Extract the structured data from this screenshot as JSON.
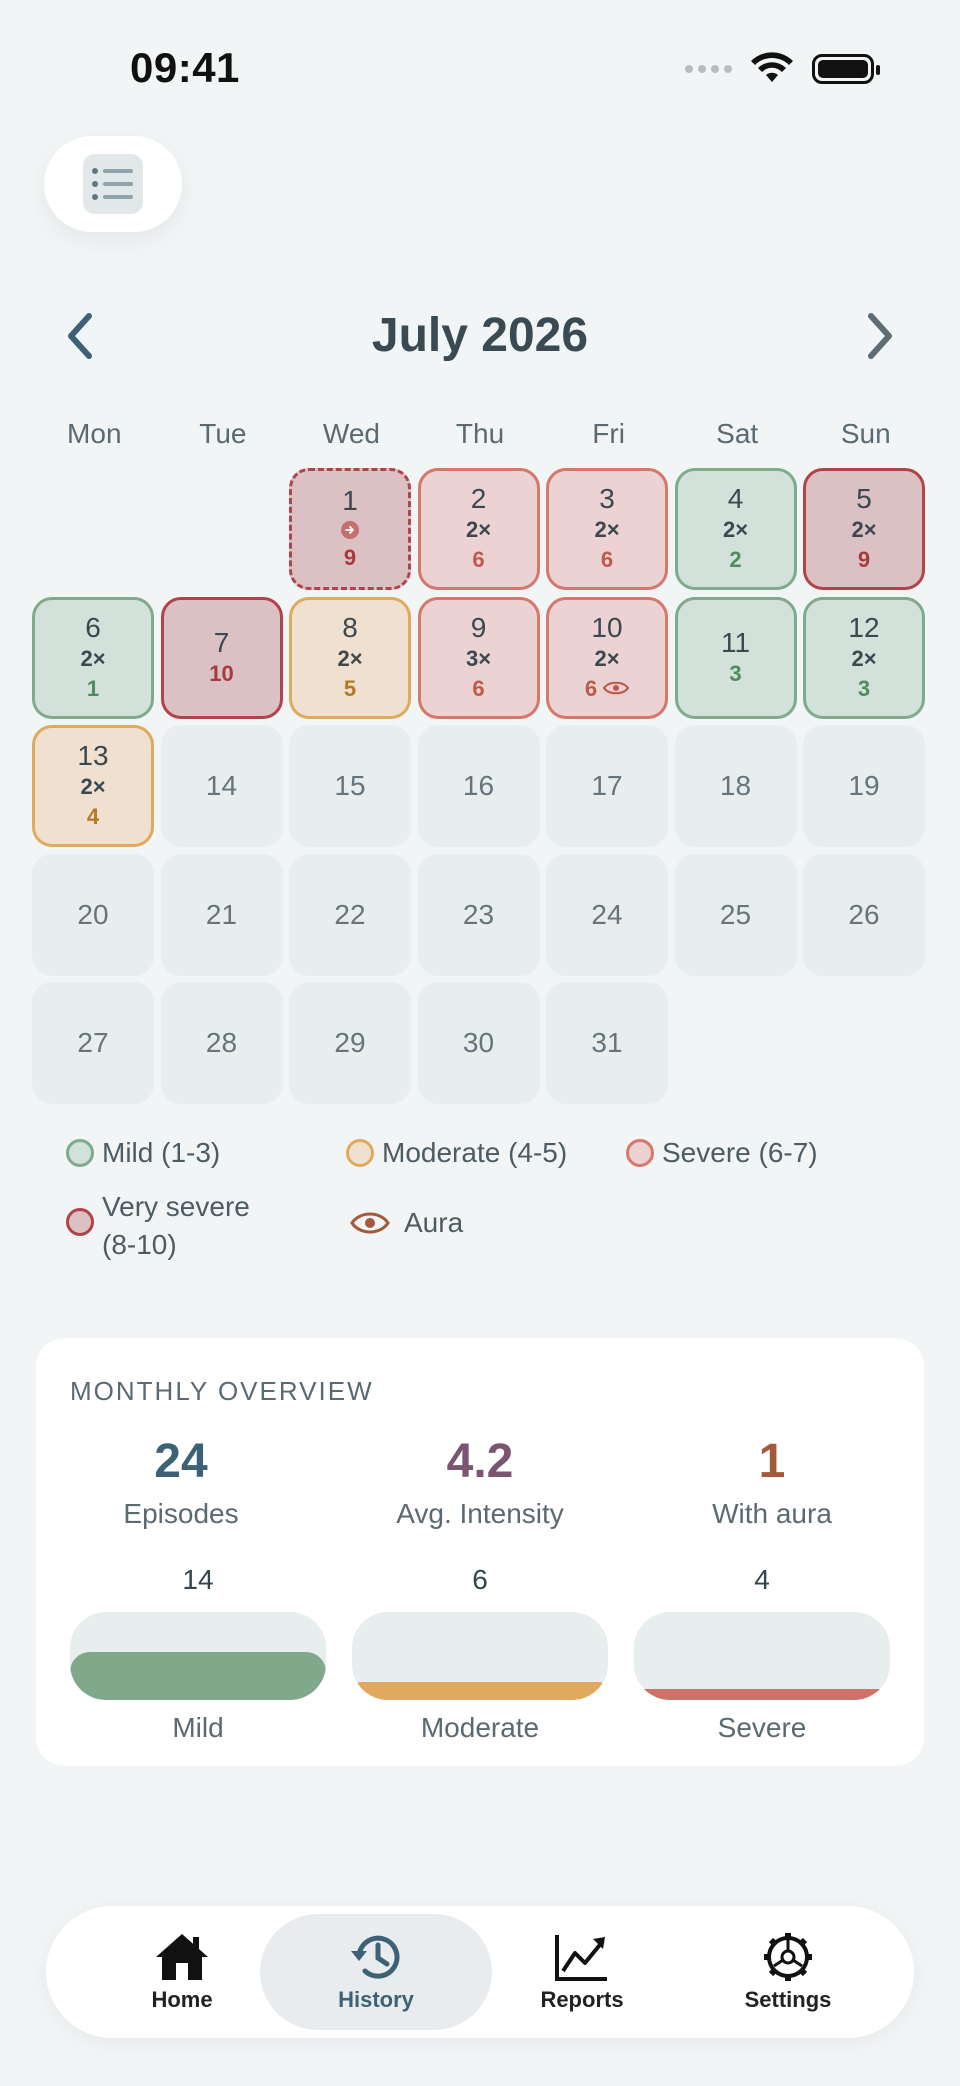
{
  "status_bar": {
    "time": "09:41"
  },
  "header": {
    "month_title": "July 2026"
  },
  "weekdays": [
    "Mon",
    "Tue",
    "Wed",
    "Thu",
    "Fri",
    "Sat",
    "Sun"
  ],
  "calendar": {
    "lead_blanks": 2,
    "days": [
      {
        "day": "1",
        "count": "",
        "score": "9",
        "severity": "vsev",
        "today": true,
        "marker": true
      },
      {
        "day": "2",
        "count": "2×",
        "score": "6",
        "severity": "sev"
      },
      {
        "day": "3",
        "count": "2×",
        "score": "6",
        "severity": "sev"
      },
      {
        "day": "4",
        "count": "2×",
        "score": "2",
        "severity": "mild"
      },
      {
        "day": "5",
        "count": "2×",
        "score": "9",
        "severity": "vsev"
      },
      {
        "day": "6",
        "count": "2×",
        "score": "1",
        "severity": "mild"
      },
      {
        "day": "7",
        "count": "",
        "score": "10",
        "severity": "vsev"
      },
      {
        "day": "8",
        "count": "2×",
        "score": "5",
        "severity": "mod"
      },
      {
        "day": "9",
        "count": "3×",
        "score": "6",
        "severity": "sev"
      },
      {
        "day": "10",
        "count": "2×",
        "score": "6",
        "severity": "sev",
        "aura": true
      },
      {
        "day": "11",
        "count": "",
        "score": "3",
        "severity": "mild"
      },
      {
        "day": "12",
        "count": "2×",
        "score": "3",
        "severity": "mild"
      },
      {
        "day": "13",
        "count": "2×",
        "score": "4",
        "severity": "mod"
      },
      {
        "day": "14"
      },
      {
        "day": "15"
      },
      {
        "day": "16"
      },
      {
        "day": "17"
      },
      {
        "day": "18"
      },
      {
        "day": "19"
      },
      {
        "day": "20"
      },
      {
        "day": "21"
      },
      {
        "day": "22"
      },
      {
        "day": "23"
      },
      {
        "day": "24"
      },
      {
        "day": "25"
      },
      {
        "day": "26"
      },
      {
        "day": "27"
      },
      {
        "day": "28"
      },
      {
        "day": "29"
      },
      {
        "day": "30"
      },
      {
        "day": "31"
      }
    ]
  },
  "legend": {
    "mild": "Mild (1-3)",
    "moderate": "Moderate (4-5)",
    "severe": "Severe (6-7)",
    "very_severe_1": "Very severe",
    "very_severe_2": "(8-10)",
    "aura": "Aura"
  },
  "colors": {
    "mild": "#7fab8b",
    "moderate": "#e0aa5e",
    "severe": "#d5776a",
    "very_severe": "#b04448",
    "episodes_value": "#3d6275",
    "intensity_value": "#7a5572",
    "aura_value": "#a4593a"
  },
  "overview": {
    "title": "MONTHLY OVERVIEW",
    "episodes_value": "24",
    "episodes_label": "Episodes",
    "intensity_value": "4.2",
    "intensity_label": "Avg. Intensity",
    "aura_value": "1",
    "aura_label": "With aura",
    "bars": [
      {
        "count": "14",
        "label": "Mild",
        "fraction": 0.55
      },
      {
        "count": "6",
        "label": "Moderate",
        "fraction": 0.2
      },
      {
        "count": "4",
        "label": "Severe",
        "fraction": 0.13
      }
    ]
  },
  "tabs": [
    {
      "label": "Home",
      "icon": "house-icon"
    },
    {
      "label": "History",
      "icon": "history-icon",
      "active": true
    },
    {
      "label": "Reports",
      "icon": "chart-icon"
    },
    {
      "label": "Settings",
      "icon": "gear-icon"
    }
  ]
}
